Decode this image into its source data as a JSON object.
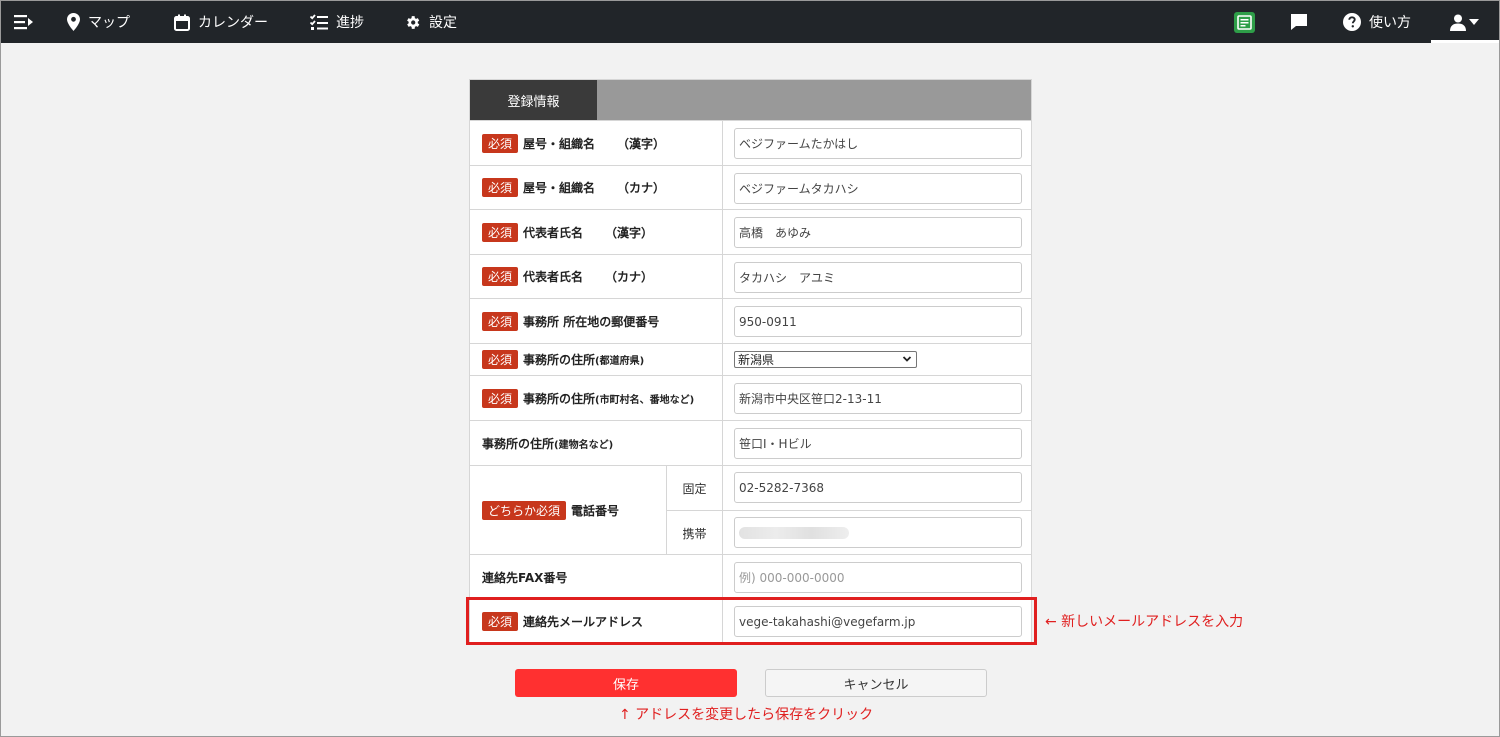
{
  "nav": {
    "map": "マップ",
    "calendar": "カレンダー",
    "progress": "進捗",
    "settings": "設定",
    "help": "使い方"
  },
  "panel": {
    "tab": "登録情報"
  },
  "badges": {
    "required": "必須",
    "either_required": "どちらか必須"
  },
  "form": {
    "org_name_kanji": {
      "label": "屋号・組織名",
      "suffix": "（漢字）",
      "value": "ベジファームたかはし"
    },
    "org_name_kana": {
      "label": "屋号・組織名",
      "suffix": "（カナ）",
      "value": "ベジファームタカハシ"
    },
    "rep_name_kanji": {
      "label": "代表者氏名",
      "suffix": "（漢字）",
      "value": "高橋　あゆみ"
    },
    "rep_name_kana": {
      "label": "代表者氏名",
      "suffix": "（カナ）",
      "value": "タカハシ　アユミ"
    },
    "postal": {
      "label": "事務所 所在地の郵便番号",
      "value": "950-0911"
    },
    "prefecture": {
      "label": "事務所の住所",
      "small": "(都道府県)",
      "value": "新潟県"
    },
    "city": {
      "label": "事務所の住所",
      "small": "(市町村名、番地など)",
      "value": "新潟市中央区笹口2-13-11"
    },
    "building": {
      "label": "事務所の住所",
      "small": "(建物名など)",
      "value": "笹口I・Hビル"
    },
    "phone": {
      "label": "電話番号",
      "fixed_label": "固定",
      "fixed_value": "02-5282-7368",
      "mobile_label": "携帯"
    },
    "fax": {
      "label": "連絡先FAX番号",
      "placeholder": "例) 000-000-0000"
    },
    "email": {
      "label": "連絡先メールアドレス",
      "value": "vege-takahashi@vegefarm.jp"
    }
  },
  "buttons": {
    "save": "保存",
    "cancel": "キャンセル"
  },
  "annotations": {
    "right": "← 新しいメールアドレスを入力",
    "bottom": "↑ アドレスを変更したら保存をクリック"
  },
  "colors": {
    "nav_bg": "#212529",
    "badge": "#c7371c",
    "save_button": "#ff3030",
    "annotation": "#e02020",
    "book_icon": "#2e9e48"
  }
}
